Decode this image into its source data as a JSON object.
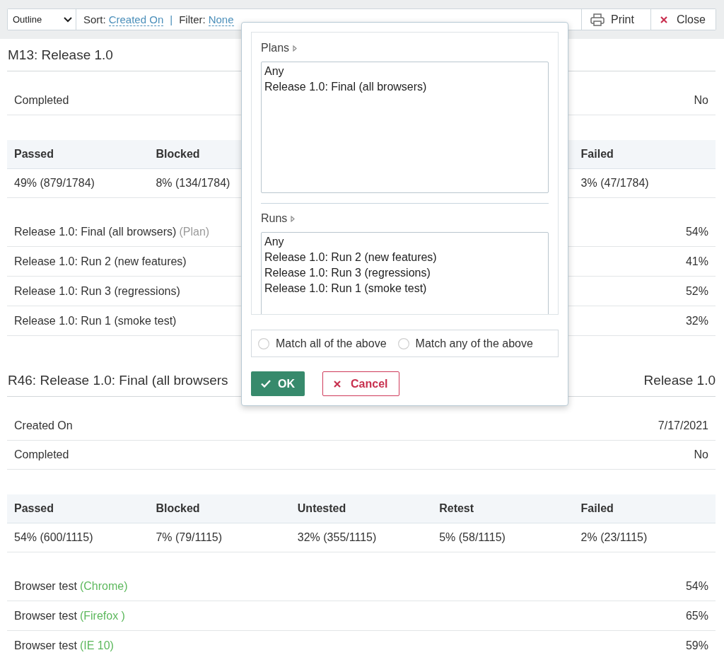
{
  "toolbar": {
    "view_select": {
      "value": "Outline"
    },
    "sort": {
      "label": "Sort:",
      "value": "Created On"
    },
    "separator": "|",
    "filter": {
      "label": "Filter:",
      "value": "None"
    },
    "buttons": [
      {
        "label": "Print",
        "kind": "print"
      },
      {
        "label": "Close",
        "kind": "close"
      }
    ]
  },
  "sections": [
    {
      "title": "M13: Release 1.0",
      "fields": [
        {
          "label": "Completed",
          "value": "No"
        }
      ],
      "stats": [
        {
          "header": "Passed",
          "value": "49% (879/1784)"
        },
        {
          "header": "Blocked",
          "value": "8% (134/1784)"
        },
        {
          "header": "Failed",
          "value": "3% (47/1784)"
        }
      ],
      "runs": [
        {
          "kind": "plan",
          "name": "Release 1.0: Final (all browsers)",
          "tag": "(Plan)",
          "percent": "54%"
        },
        {
          "kind": "run",
          "name": "Release 1.0: Run 2 (new features)",
          "percent": "41%"
        },
        {
          "kind": "run",
          "name": "Release 1.0: Run 3 (regressions)",
          "percent": "52%"
        },
        {
          "kind": "run",
          "name": "Release 1.0: Run 1 (smoke test)",
          "percent": "32%"
        }
      ]
    },
    {
      "title": "R46: Release 1.0: Final (all browsers",
      "milestone": "Release 1.0",
      "fields": [
        {
          "label": "Created On",
          "value": "7/17/2021"
        },
        {
          "label": "Completed",
          "value": "No"
        }
      ],
      "stats": [
        {
          "header": "Passed",
          "value": "54% (600/1115)"
        },
        {
          "header": "Blocked",
          "value": "7% (79/1115)"
        },
        {
          "header": "Untested",
          "value": "32% (355/1115)"
        },
        {
          "header": "Retest",
          "value": "5% (58/1115)"
        },
        {
          "header": "Failed",
          "value": "2% (23/1115)"
        }
      ],
      "runs": [
        {
          "kind": "configuration",
          "name": "Browser test",
          "tag": "(Chrome)",
          "percent": "54%"
        },
        {
          "kind": "configuration",
          "name": "Browser test",
          "tag": "(Firefox )",
          "percent": "65%"
        },
        {
          "kind": "configuration",
          "name": "Browser test",
          "tag": "(IE 10)",
          "percent": "59%"
        }
      ]
    }
  ],
  "filter_dialog": {
    "plans": {
      "label": "Plans",
      "options": [
        {
          "label": "Any",
          "selected": false
        },
        {
          "label": "Release 1.0: Final (all browsers)",
          "selected": false
        }
      ]
    },
    "runs": {
      "label": "Runs",
      "options": [
        {
          "label": "Any",
          "selected": false
        },
        {
          "label": "Release 1.0: Run 2 (new features)",
          "selected": false
        },
        {
          "label": "Release 1.0: Run 3 (regressions)",
          "selected": false
        },
        {
          "label": "Release 1.0: Run 1 (smoke test)",
          "selected": false
        }
      ]
    },
    "match_options": [
      {
        "label": "Match all of the above",
        "selected": false
      },
      {
        "label": "Match any of the above",
        "selected": false
      }
    ],
    "buttons": [
      {
        "label": "OK",
        "kind": "ok"
      },
      {
        "label": "Cancel",
        "kind": "cancel"
      }
    ]
  }
}
